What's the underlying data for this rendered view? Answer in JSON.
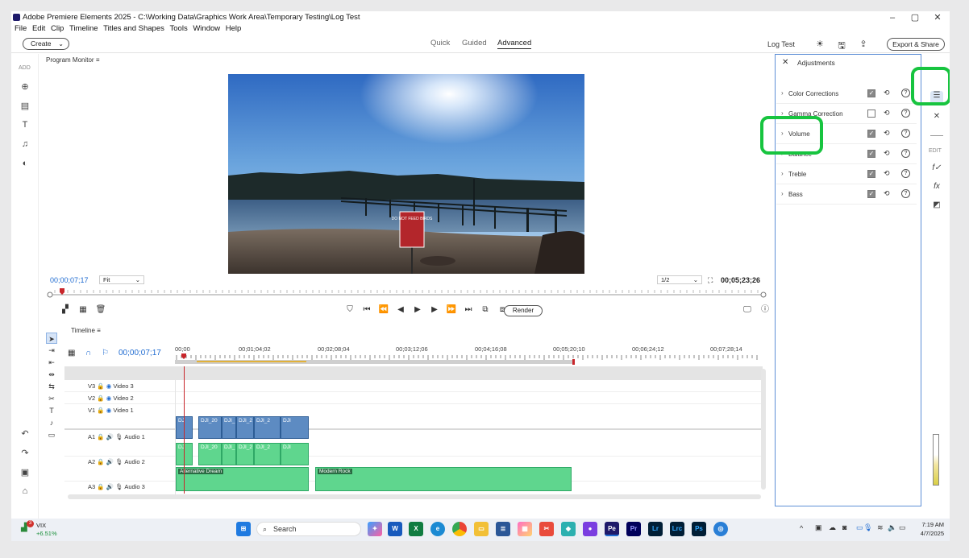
{
  "window": {
    "title": "Adobe Premiere Elements 2025 - C:\\Working Data\\Graphics Work Area\\Temporary Testing\\Log Test",
    "controls": [
      "–",
      "▢",
      "✕"
    ]
  },
  "menu": [
    "File",
    "Edit",
    "Clip",
    "Timeline",
    "Titles and Shapes",
    "Tools",
    "Window",
    "Help"
  ],
  "modebar": {
    "create_label": "Create",
    "tabs": [
      "Quick",
      "Guided",
      "Advanced"
    ],
    "active_tab": "Advanced",
    "project_name": "Log Test",
    "export_label": "Export & Share"
  },
  "left_rail": {
    "add_label": "ADD"
  },
  "program_monitor": {
    "title": "Program Monitor",
    "sign_text": "DO NOT FEED BIRDS",
    "timecode": "00;00;07;17",
    "fit": "Fit",
    "resolution": "1/2",
    "duration": "00;05;23;26",
    "render_label": "Render"
  },
  "timeline": {
    "title": "Timeline",
    "timecode": "00;00;07;17",
    "ruler": [
      "00;00",
      "00;01;04;02",
      "00;02;08;04",
      "00;03;12;06",
      "00;04;16;08",
      "00;05;20;10",
      "00;06;24;12",
      "00;07;28;14"
    ],
    "tracks": [
      {
        "id": "V3",
        "name": "Video 3"
      },
      {
        "id": "V2",
        "name": "Video 2"
      },
      {
        "id": "V1",
        "name": "Video 1"
      },
      {
        "id": "A1",
        "name": "Audio 1"
      },
      {
        "id": "A2",
        "name": "Audio 2"
      },
      {
        "id": "A3",
        "name": "Audio 3"
      }
    ],
    "video_clips": [
      "DJ",
      "DJI_20",
      "DJI_",
      "DJI_2",
      "DJI_2",
      "DJI"
    ],
    "audio1_clips": [
      "DJ",
      "DJI_20",
      "DJI_",
      "DJI_2",
      "DJI_2",
      "DJI"
    ],
    "audio2_clips": [
      "Alternative Dream",
      "Modern Rock"
    ]
  },
  "adjustments": {
    "title": "Adjustments",
    "rows": [
      {
        "label": "Color Corrections",
        "checked": true
      },
      {
        "label": "Gamma Correction",
        "checked": false
      },
      {
        "label": "Volume",
        "checked": true
      },
      {
        "label": "Balance",
        "checked": true
      },
      {
        "label": "Treble",
        "checked": true
      },
      {
        "label": "Bass",
        "checked": true
      }
    ]
  },
  "right_rail": {
    "edit_label": "EDIT"
  },
  "taskbar": {
    "stock_name": "VIX",
    "stock_change": "+6.51%",
    "badge": "3",
    "search_placeholder": "Search",
    "time": "7:19 AM",
    "date": "4/7/2025"
  },
  "colors": {
    "accent": "#1f6bd1",
    "callout": "#17c43f",
    "video_clip": "#5d8bc2",
    "audio_clip": "#5fd68e",
    "playhead": "#c8262b"
  }
}
